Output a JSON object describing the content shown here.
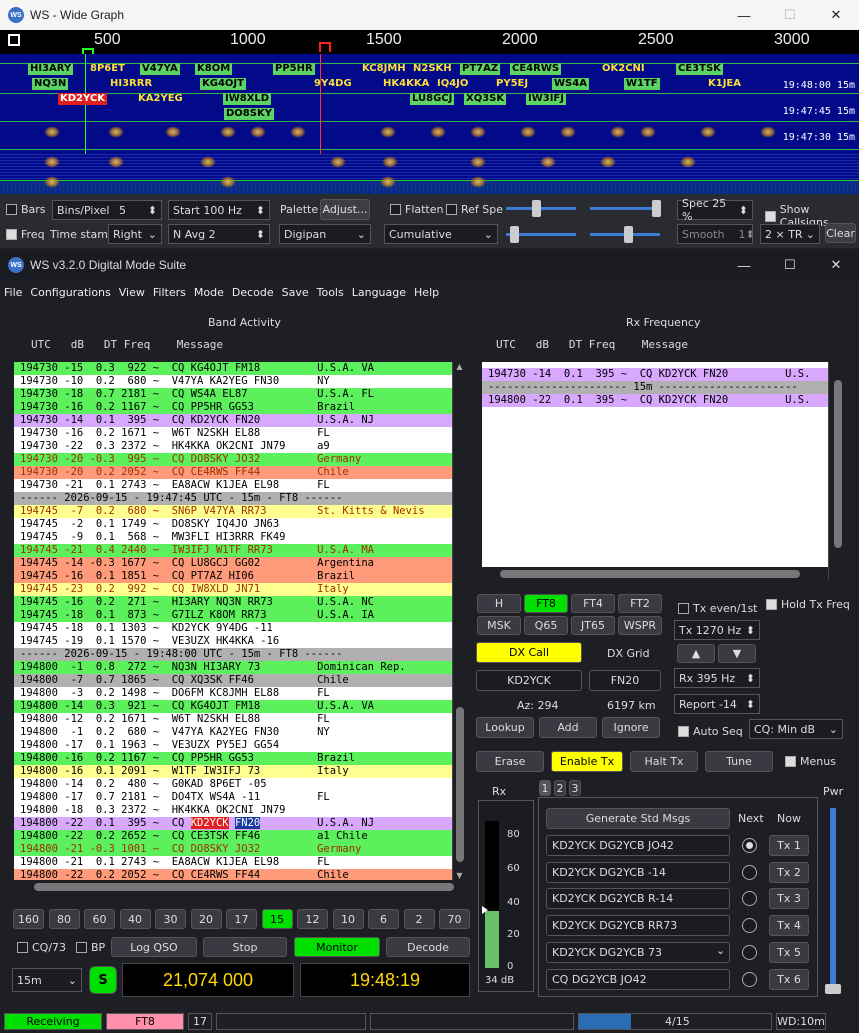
{
  "wide": {
    "title": "WS - Wide Graph",
    "ticks": [
      "500",
      "1000",
      "1500",
      "2000",
      "2500",
      "3000"
    ],
    "times": [
      "19:48:00  15m",
      "19:47:45  15m",
      "19:47:30  15m"
    ],
    "calls": [
      {
        "t": "HI3ARY",
        "c": "g"
      },
      {
        "t": "8P6ET",
        "c": "y"
      },
      {
        "t": "V47YA",
        "c": "g"
      },
      {
        "t": "K8OM",
        "c": "g"
      },
      {
        "t": "PP5HR",
        "c": "g"
      },
      {
        "t": "KC8JMH",
        "c": "y"
      },
      {
        "t": "N2SKH",
        "c": "y"
      },
      {
        "t": "PT7AZ",
        "c": "g"
      },
      {
        "t": "CE4RWS",
        "c": "g"
      },
      {
        "t": "OK2CNI",
        "c": "y"
      },
      {
        "t": "CE3TSK",
        "c": "g"
      },
      {
        "t": "NQ3N",
        "c": "g"
      },
      {
        "t": "HI3RRR",
        "c": "y"
      },
      {
        "t": "KG4OJT",
        "c": "g"
      },
      {
        "t": "9Y4DG",
        "c": "y"
      },
      {
        "t": "HK4KKA",
        "c": "y"
      },
      {
        "t": "IQ4JO",
        "c": "y"
      },
      {
        "t": "PY5EJ",
        "c": "y"
      },
      {
        "t": "WS4A",
        "c": "g"
      },
      {
        "t": "W1TF",
        "c": "g"
      },
      {
        "t": "K1JEA",
        "c": "y"
      },
      {
        "t": "KD2YCK",
        "c": "r"
      },
      {
        "t": "KA2YEG",
        "c": "y"
      },
      {
        "t": "IW8XLD",
        "c": "g"
      },
      {
        "t": "LU8GCJ",
        "c": "g"
      },
      {
        "t": "XQ3SK",
        "c": "g"
      },
      {
        "t": "IW3IFJ",
        "c": "g"
      },
      {
        "t": "DO8SKY",
        "c": "g"
      }
    ],
    "bars_label": "Bars",
    "bins_label": "Bins/Pixel",
    "bins_value": "5",
    "start_label": "Start 100 Hz",
    "palette_label": "Palette",
    "adjust_label": "Adjust...",
    "flatten_label": "Flatten",
    "refspec_label": "Ref Spe",
    "spec_label": "Spec 25 %",
    "show_callsigns_label": "Show Callsigns",
    "freq_label": "Freq",
    "timestamp_label": "Time stamp",
    "timestamp_value": "Right",
    "navg_label": "N Avg 2",
    "palette_value": "Digipan",
    "cumulative_value": "Cumulative",
    "smooth_label": "Smooth",
    "smooth_value": "1",
    "tr_label": "2 × TR",
    "clear_label": "Clear"
  },
  "main": {
    "title": "WS   v3.2.0  Digital Mode Suite",
    "menu": [
      "File",
      "Configurations",
      "View",
      "Filters",
      "Mode",
      "Decode",
      "Save",
      "Tools",
      "Language",
      "Help"
    ],
    "band_title": "Band Activity",
    "rx_title": "Rx Frequency",
    "band_header": "UTC   dB   DT Freq    Message",
    "rx_header": "UTC   dB   DT Freq    Message",
    "band_rows": [
      {
        "t": "194730 -15  0.3  922 ~  CQ KG4OJT FM18         U.S.A. VA",
        "bg": "#5cf05c"
      },
      {
        "t": "194730 -10  0.2  680 ~  V47YA KA2YEG FN30      NY",
        "bg": "#fff"
      },
      {
        "t": "194730 -18  0.7 2181 ~  CQ WS4A EL87           U.S.A. FL",
        "bg": "#5cf05c"
      },
      {
        "t": "194730 -16  0.2 1167 ~  CQ PP5HR GG53          Brazil",
        "bg": "#5cf05c"
      },
      {
        "t": "194730 -14  0.1  395 ~  CQ KD2YCK FN20         U.S.A. NJ",
        "bg": "#d8a8ff"
      },
      {
        "t": "194730 -16  0.2 1671 ~  W6T N2SKH EL88         FL",
        "bg": "#fff"
      },
      {
        "t": "194730 -22  0.3 2372 ~  HK4KKA OK2CNI JN79     a9",
        "bg": "#fff"
      },
      {
        "t": "194730 -20 -0.3  995 ~  CQ DO8SKY JO32         Germany",
        "bg": "#5cf05c",
        "fg": "#a03000"
      },
      {
        "t": "194730 -20  0.2 2052 ~  CQ CE4RWS FF44         Chile",
        "bg": "#ff9a7a",
        "fg": "#a03000"
      },
      {
        "t": "194730 -21  0.1 2743 ~  EA8ACW K1JEA EL98      FL",
        "bg": "#fff"
      },
      {
        "t": "------ 2026-09-15 - 19:47:45 UTC - 15m - FT8 ------",
        "bg": "#b0b0b0"
      },
      {
        "t": "194745  -7  0.2  680 ~  SN6P V47YA RR73        St. Kitts & Nevis",
        "bg": "#ffff90",
        "fg": "#a03000"
      },
      {
        "t": "194745  -2  0.1 1749 ~  DO8SKY IQ4JO JN63",
        "bg": "#fff"
      },
      {
        "t": "194745  -9  0.1  568 ~  MW3FLI HI3RRR FK49",
        "bg": "#fff"
      },
      {
        "t": "194745 -21  0.4 2440 ~  IW3IFJ W1TF RR73       U.S.A. MA",
        "bg": "#5cf05c",
        "fg": "#a03000"
      },
      {
        "t": "194745 -14 -0.3 1677 ~  CQ LU8GCJ GG02         Argentina",
        "bg": "#ff9a7a"
      },
      {
        "t": "194745 -16  0.1 1851 ~  CQ PT7AZ HI06          Brazil",
        "bg": "#ff9a7a"
      },
      {
        "t": "194745 -23  0.2  992 ~  CQ IW8XLD JN71         Italy",
        "bg": "#ffff90",
        "fg": "#a03000"
      },
      {
        "t": "194745 -16  0.2  271 ~  HI3ARY NQ3N RR73       U.S.A. NC",
        "bg": "#5cf05c"
      },
      {
        "t": "194745 -18  0.1  873 ~  G7ILZ K8OM RR73        U.S.A. IA",
        "bg": "#5cf05c"
      },
      {
        "t": "194745 -18  0.1 1303 ~  KD2YCK 9Y4DG -11",
        "bg": "#fff"
      },
      {
        "t": "194745 -19  0.1 1570 ~  VE3UZX HK4KKA -16",
        "bg": "#fff"
      },
      {
        "t": "------ 2026-09-15 - 19:48:00 UTC - 15m - FT8 ------",
        "bg": "#b0b0b0"
      },
      {
        "t": "194800  -1  0.8  272 ~  NQ3N HI3ARY 73         Dominican Rep.",
        "bg": "#5cf05c"
      },
      {
        "t": "194800  -7  0.7 1865 ~  CQ XQ3SK FF46          Chile",
        "bg": "#b0b0b0"
      },
      {
        "t": "194800  -3  0.2 1498 ~  DO6FM KC8JMH EL88      FL",
        "bg": "#fff"
      },
      {
        "t": "194800 -14  0.3  921 ~  CQ KG4OJT FM18         U.S.A. VA",
        "bg": "#5cf05c"
      },
      {
        "t": "194800 -12  0.2 1671 ~  W6T N2SKH EL88         FL",
        "bg": "#fff"
      },
      {
        "t": "194800  -1  0.2  680 ~  V47YA KA2YEG FN30      NY",
        "bg": "#fff"
      },
      {
        "t": "194800 -17  0.1 1963 ~  VE3UZX PY5EJ GG54",
        "bg": "#fff"
      },
      {
        "t": "194800 -16  0.2 1167 ~  CQ PP5HR GG53          Brazil",
        "bg": "#5cf05c"
      },
      {
        "t": "194800 -16  0.1 2091 ~  W1TF IW3IFJ 73         Italy",
        "bg": "#ffff90"
      },
      {
        "t": "194800 -14  0.2  480 ~  G0KAD 8P6ET -05",
        "bg": "#fff"
      },
      {
        "t": "194800 -17  0.7 2181 ~  DO4TX WS4A -11         FL",
        "bg": "#fff"
      },
      {
        "t": "194800 -18  0.3 2372 ~  HK4KKA OK2CNI JN79",
        "bg": "#fff"
      },
      {
        "t": "194800 -22  0.1  395 ~  CQ KD2YCK FN20         U.S.A. NJ",
        "bg": "#d8a8ff",
        "mark": true
      },
      {
        "t": "194800 -22  0.2 2652 ~  CQ CE3TSK FF46         a1 Chile",
        "bg": "#5cf05c"
      },
      {
        "t": "194800 -21 -0.3 1001 ~  CQ DO8SKY JO32         Germany",
        "bg": "#5cf05c",
        "fg": "#a03000"
      },
      {
        "t": "194800 -21  0.1 2743 ~  EA8ACW K1JEA EL98      FL",
        "bg": "#fff"
      },
      {
        "t": "194800 -22  0.2 2052 ~  CQ CE4RWS FF44         Chile",
        "bg": "#ff9a7a"
      }
    ],
    "rx_rows": [
      {
        "t": "194730 -14  0.1  395 ~  CQ KD2YCK FN20         U.S.",
        "bg": "#d8a8ff"
      },
      {
        "t": "---------------------- 15m ----------------------",
        "bg": "#b0b0b0"
      },
      {
        "t": "194800 -22  0.1  395 ~  CQ KD2YCK FN20         U.S.",
        "bg": "#d8a8ff"
      }
    ],
    "modes": [
      "H",
      "FT8",
      "FT4",
      "FT2",
      "MSK",
      "Q65",
      "JT65",
      "WSPR"
    ],
    "tx_even": "Tx even/1st",
    "hold_tx": "Hold Tx Freq",
    "tx_freq": "Tx  1270  Hz",
    "rx_freq": "Rx  395  Hz",
    "report": "Report -14",
    "auto_seq": "Auto Seq",
    "cq_value": "CQ: Min dB",
    "dx_call_label": "DX Call",
    "dx_grid_label": "DX Grid",
    "dx_call": "KD2YCK",
    "dx_grid": "FN20",
    "az": "Az: 294",
    "dist": "6197 km",
    "lookup": "Lookup",
    "add": "Add",
    "ignore": "Ignore",
    "erase": "Erase",
    "enable_tx": "Enable Tx",
    "halt_tx": "Halt Tx",
    "tune": "Tune",
    "menus": "Menus",
    "bands": [
      "160",
      "80",
      "60",
      "40",
      "30",
      "20",
      "17",
      "15",
      "12",
      "10",
      "6",
      "2",
      "70"
    ],
    "cq73": "CQ/73",
    "bp": "BP",
    "log_qso": "Log QSO",
    "stop": "Stop",
    "monitor": "Monitor",
    "decode": "Decode",
    "band_value": "15m",
    "s_label": "S",
    "frequency": "21,074 000",
    "clock": "19:48:19",
    "rx_label": "Rx",
    "pwr_label": "Pwr",
    "db": "34 dB",
    "meter_ticks": [
      "80",
      "60",
      "40",
      "20",
      "0"
    ],
    "tabs": [
      "1",
      "2",
      "3"
    ],
    "gen_std": "Generate Std Msgs",
    "next": "Next",
    "now": "Now",
    "tx_msgs": [
      "KD2YCK DG2YCB JO42",
      "KD2YCK DG2YCB -14",
      "KD2YCK DG2YCB R-14",
      "KD2YCK DG2YCB RR73",
      "KD2YCK DG2YCB 73",
      "CQ DG2YCB JO42"
    ],
    "tx_btns": [
      "Tx 1",
      "Tx 2",
      "Tx 3",
      "Tx 4",
      "Tx 5",
      "Tx 6"
    ],
    "status": {
      "receiving": "Receiving",
      "mode": "FT8",
      "num": "17",
      "progress": "4/15",
      "wd": "WD:10m"
    }
  }
}
